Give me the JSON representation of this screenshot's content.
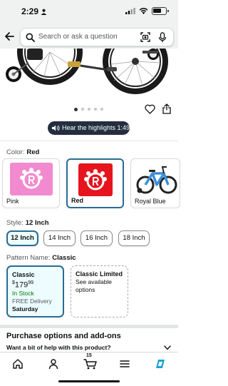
{
  "status_bar": {
    "time": "2:29"
  },
  "search": {
    "placeholder": "Search or ask a question"
  },
  "gallery": {
    "image_count": 5,
    "active_index": 0
  },
  "audio": {
    "label": "Hear the highlights 1:49"
  },
  "color": {
    "label": "Color:",
    "selected": "Red",
    "options": [
      {
        "name": "Pink",
        "color": "#f28ad0"
      },
      {
        "name": "Red",
        "color": "#e5141d"
      },
      {
        "name": "Royal Blue",
        "color": "#3b8fd9"
      }
    ]
  },
  "style": {
    "label": "Style:",
    "selected": "12 Inch",
    "options": [
      "12 Inch",
      "14 Inch",
      "16 Inch",
      "18 Inch"
    ]
  },
  "pattern": {
    "label": "Pattern Name:",
    "selected": "Classic",
    "cards": [
      {
        "title": "Classic",
        "price_whole": "179",
        "price_fraction": "99",
        "currency": "$",
        "stock": "In Stock",
        "delivery": "FREE Delivery",
        "day": "Saturday"
      },
      {
        "title": "Classic Limited",
        "note": "See available options"
      }
    ]
  },
  "purchase": {
    "title": "Purchase options and add-ons",
    "help": "Want a bit of help with this product?"
  },
  "nav": {
    "cart_count": "15"
  },
  "colors": {
    "accent": "#2a6b91",
    "dark": "#232f3e",
    "green": "#007600"
  }
}
